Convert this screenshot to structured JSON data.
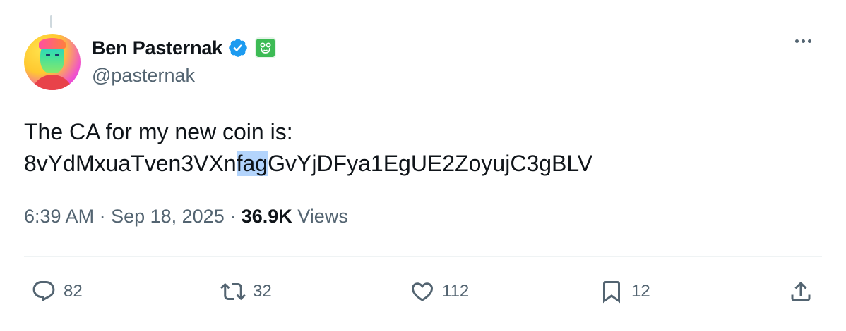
{
  "author": {
    "display_name": "Ben Pasternak",
    "handle": "@pasternak",
    "verified": true,
    "affiliate_badge": "green-frog-badge"
  },
  "tweet": {
    "line1": "The CA for my new coin is:",
    "ca_part1": "8vYdMxuaTven3VXn",
    "ca_highlight": "fag",
    "ca_part2": "GvYjDFya1EgUE2ZoyujC3gBLV"
  },
  "meta": {
    "time": "6:39 AM",
    "sep1": " · ",
    "date": "Sep 18, 2025",
    "sep2": " · ",
    "views_count": "36.9K",
    "views_label": " Views"
  },
  "actions": {
    "replies": "82",
    "reposts": "32",
    "likes": "112",
    "bookmarks": "12"
  },
  "colors": {
    "text_primary": "#0f1419",
    "text_secondary": "#536471",
    "verified_blue": "#1d9bf0",
    "highlight": "#b3d4fc",
    "divider": "#eff3f4"
  }
}
